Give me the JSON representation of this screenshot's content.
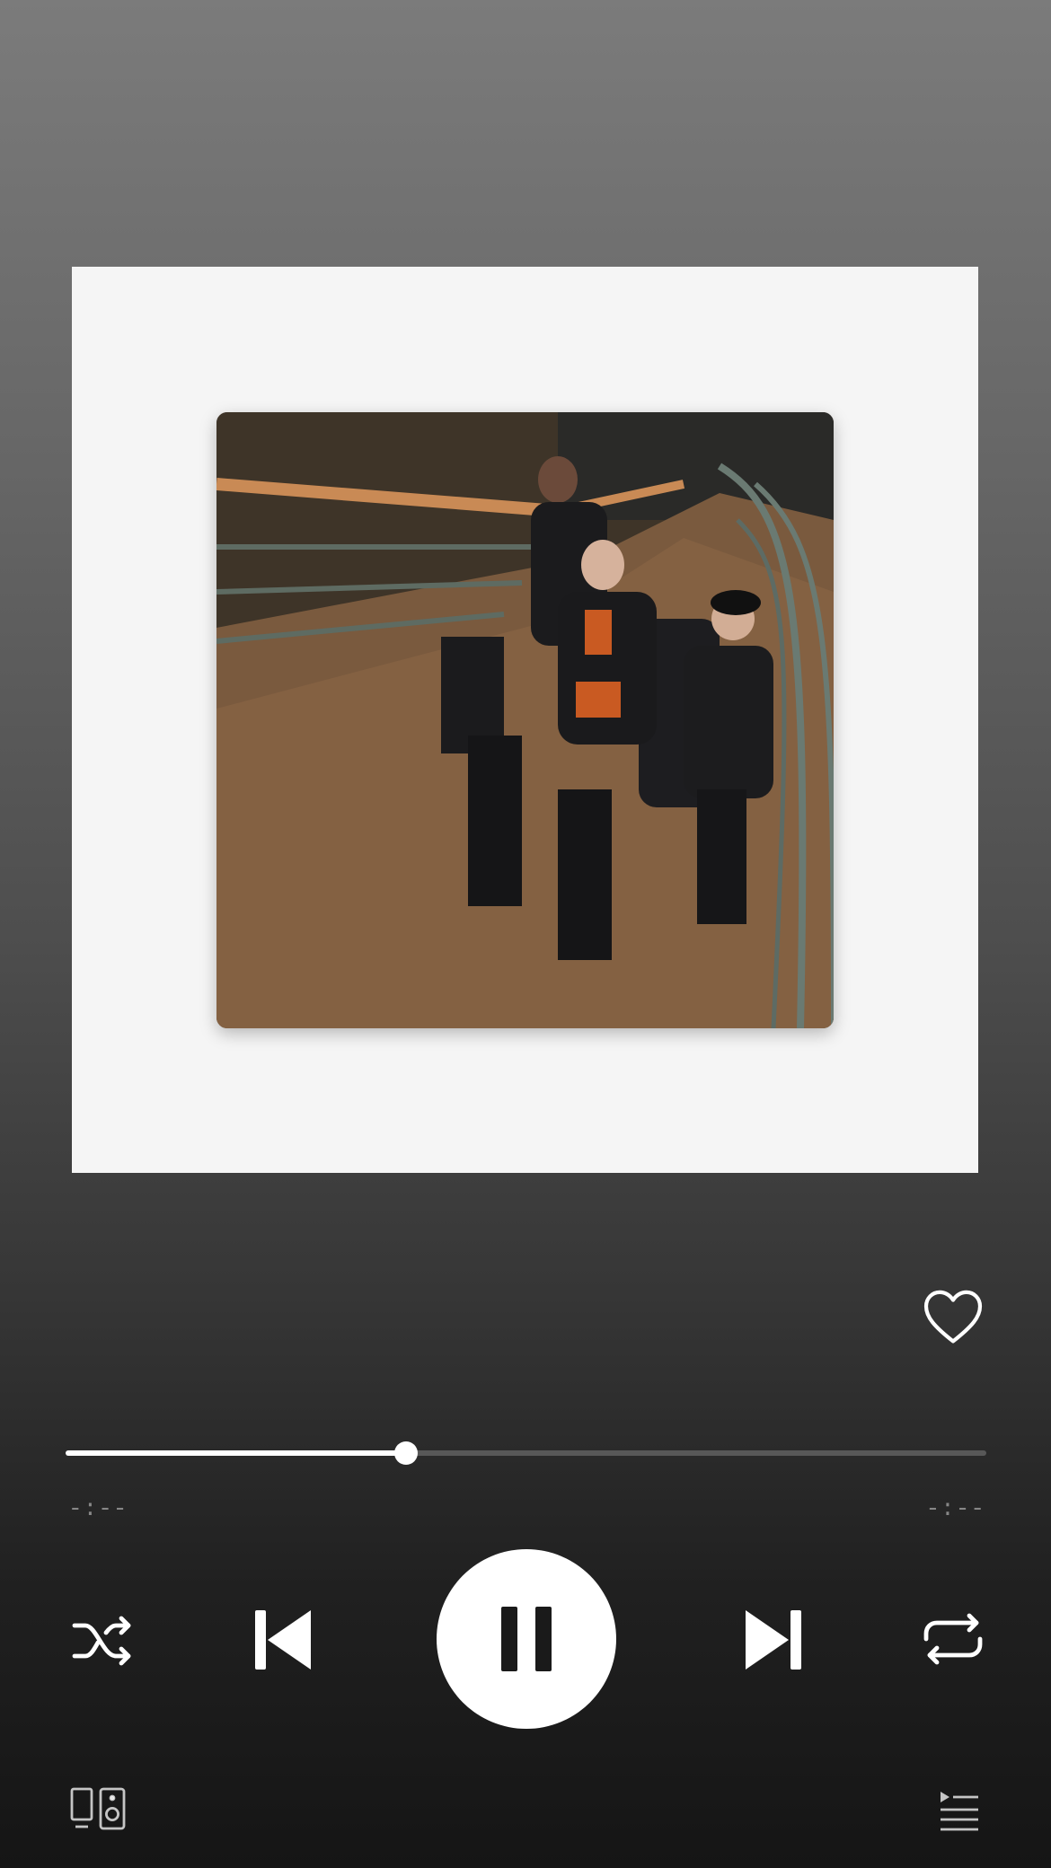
{
  "player": {
    "liked": false,
    "progress_fraction": 0.37,
    "elapsed_time": "-:--",
    "remaining_time": "-:--",
    "state": "playing"
  },
  "controls": {
    "shuffle": "shuffle-icon",
    "previous": "skip-previous-icon",
    "play_pause": "pause-icon",
    "next": "skip-next-icon",
    "repeat": "repeat-icon",
    "devices": "connect-devices-icon",
    "queue": "queue-icon",
    "like": "heart-icon"
  },
  "colors": {
    "accent": "#ffffff",
    "art_frame": "#f5f5f5"
  }
}
